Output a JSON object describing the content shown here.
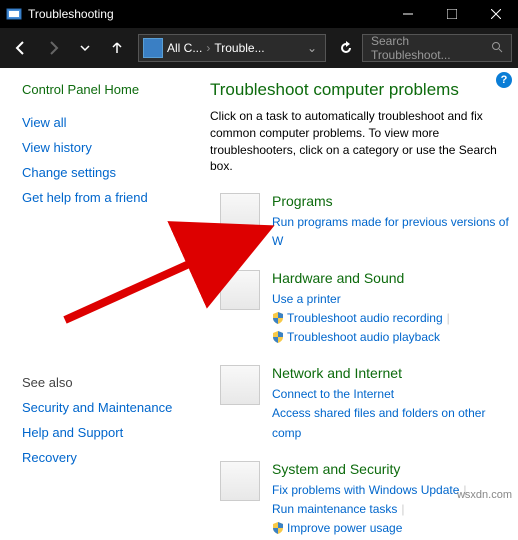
{
  "titlebar": {
    "title": "Troubleshooting"
  },
  "breadcrumb": {
    "seg1": "All C...",
    "seg2": "Trouble..."
  },
  "search": {
    "placeholder": "Search Troubleshoot..."
  },
  "sidebar": {
    "home": "Control Panel Home",
    "links": [
      "View all",
      "View history",
      "Change settings",
      "Get help from a friend"
    ]
  },
  "seealso": {
    "header": "See also",
    "links": [
      "Security and Maintenance",
      "Help and Support",
      "Recovery"
    ]
  },
  "main": {
    "heading": "Troubleshoot computer problems",
    "desc": "Click on a task to automatically troubleshoot and fix common computer problems. To view more troubleshooters, click on a category or use the Search box."
  },
  "cats": [
    {
      "title": "Programs",
      "links": [
        {
          "label": "Run programs made for previous versions of W",
          "shield": false
        }
      ]
    },
    {
      "title": "Hardware and Sound",
      "links": [
        {
          "label": "Use a printer",
          "shield": false
        },
        {
          "label": "Troubleshoot audio recording",
          "shield": true
        },
        {
          "label": "Troubleshoot audio playback",
          "shield": true
        }
      ]
    },
    {
      "title": "Network and Internet",
      "links": [
        {
          "label": "Connect to the Internet",
          "shield": false
        },
        {
          "label": "Access shared files and folders on other comp",
          "shield": false
        }
      ]
    },
    {
      "title": "System and Security",
      "links": [
        {
          "label": "Fix problems with Windows Update",
          "shield": false
        },
        {
          "label": "Run maintenance tasks",
          "shield": false
        },
        {
          "label": "Improve power usage",
          "shield": true
        }
      ]
    }
  ],
  "watermark": "wsxdn.com"
}
